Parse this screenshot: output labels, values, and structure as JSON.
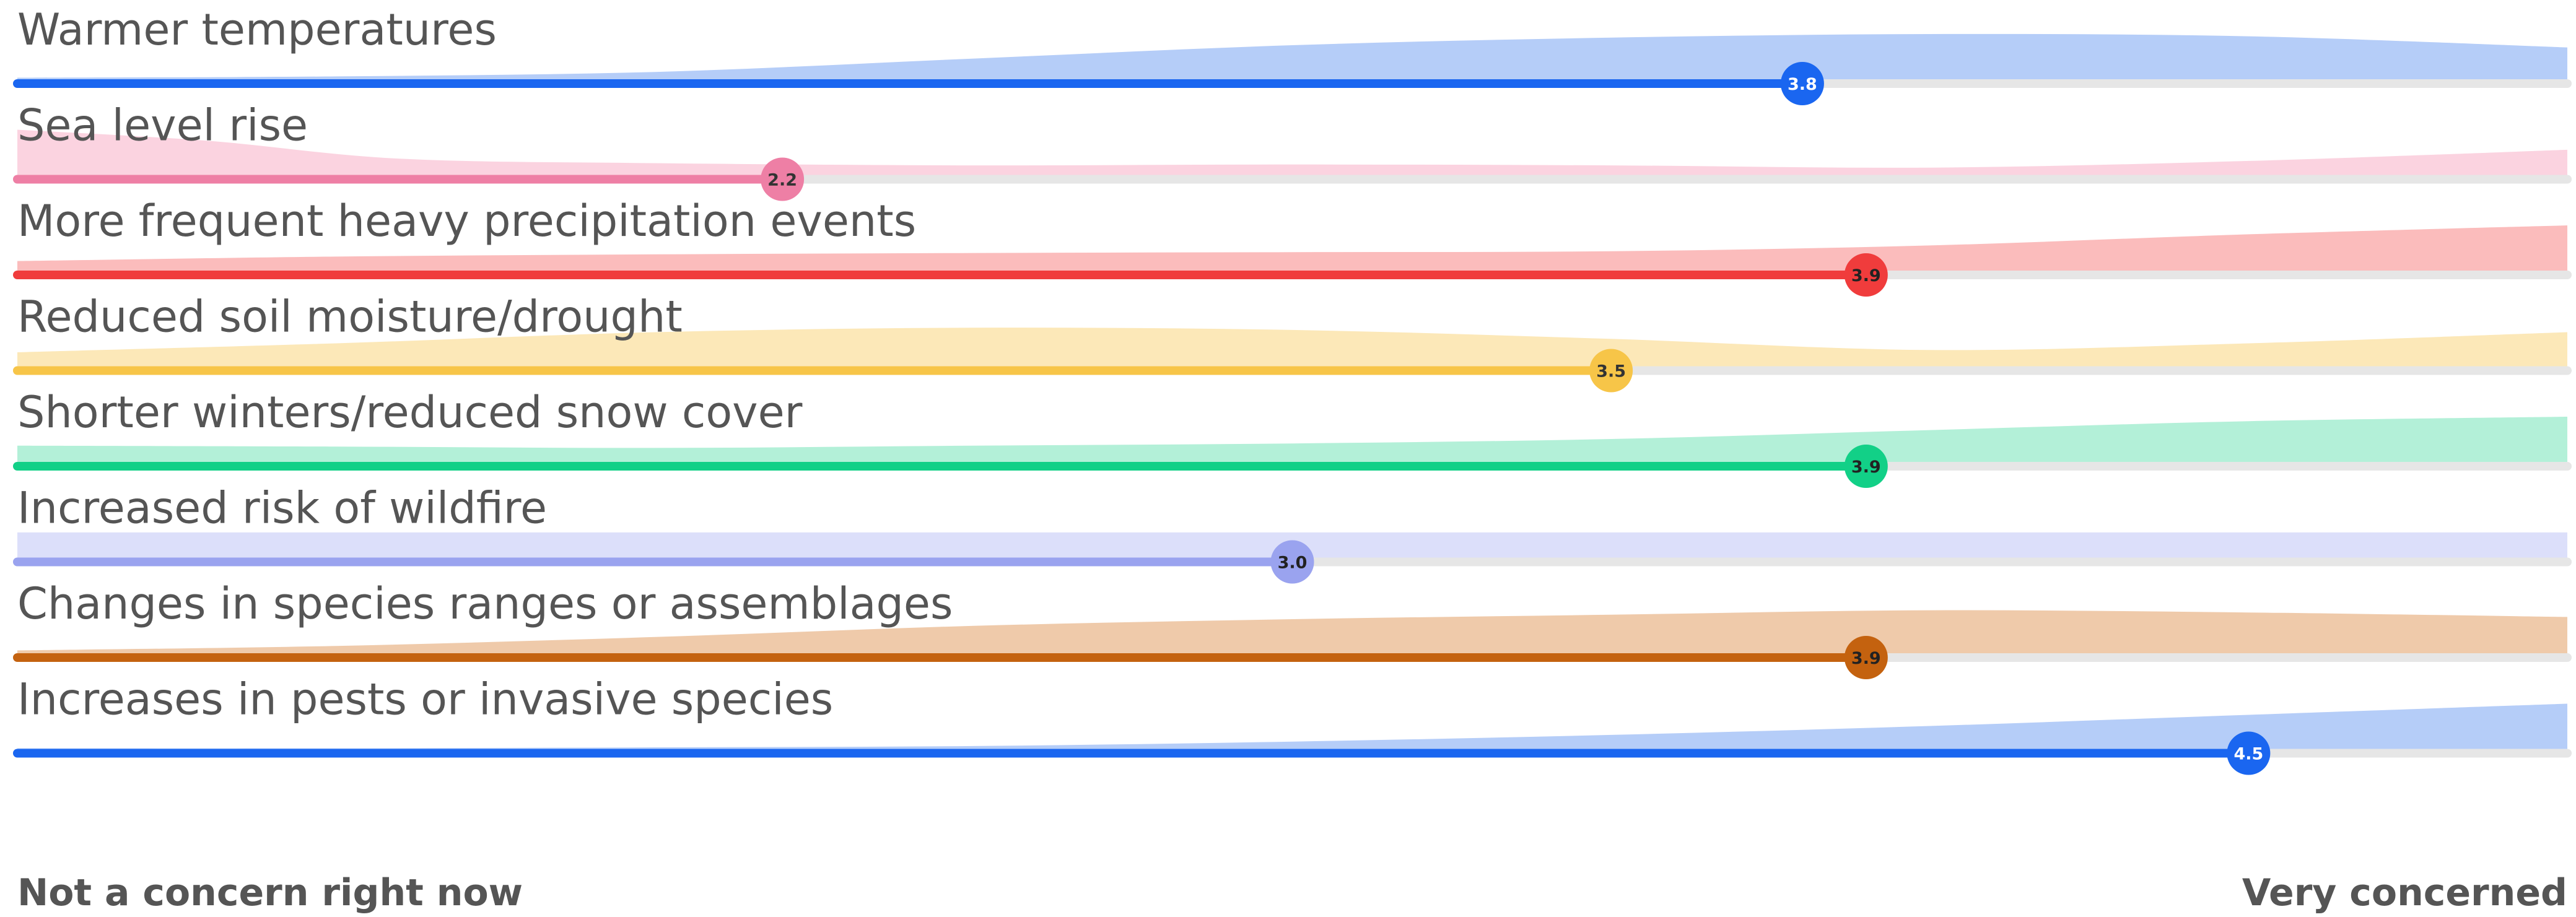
{
  "chart_data": {
    "type": "ridgeline",
    "xlim": [
      1,
      5
    ],
    "low_label": "Not a concern right now",
    "high_label": "Very concerned",
    "track_color": "#e6e6e6",
    "rows": [
      {
        "label": "Warmer temperatures",
        "mean": 3.8,
        "mean_label": "3.8",
        "color": "#1a66f0",
        "fill": "#b5cdf8",
        "label_color": "#ffffff",
        "density": [
          [
            1.0,
            0.02
          ],
          [
            1.5,
            0.05
          ],
          [
            2.0,
            0.15
          ],
          [
            2.5,
            0.45
          ],
          [
            3.0,
            0.75
          ],
          [
            3.5,
            0.92
          ],
          [
            4.0,
            1.0
          ],
          [
            4.5,
            0.95
          ],
          [
            5.0,
            0.7
          ]
        ]
      },
      {
        "label": "Sea level rise",
        "mean": 2.2,
        "mean_label": "2.2",
        "color": "#ee7fa5",
        "fill": "#fbd3e0",
        "label_color": "#333333",
        "density": [
          [
            1.0,
            1.0
          ],
          [
            1.3,
            0.75
          ],
          [
            1.6,
            0.35
          ],
          [
            2.0,
            0.25
          ],
          [
            2.5,
            0.2
          ],
          [
            3.0,
            0.22
          ],
          [
            3.5,
            0.2
          ],
          [
            4.0,
            0.15
          ],
          [
            4.5,
            0.3
          ],
          [
            5.0,
            0.55
          ]
        ]
      },
      {
        "label": "More frequent heavy precipitation events",
        "mean": 3.9,
        "mean_label": "3.9",
        "color": "#f03c3c",
        "fill": "#fbbcbc",
        "label_color": "#222222",
        "density": [
          [
            1.0,
            0.2
          ],
          [
            1.5,
            0.3
          ],
          [
            2.0,
            0.35
          ],
          [
            2.5,
            0.38
          ],
          [
            3.0,
            0.4
          ],
          [
            3.5,
            0.42
          ],
          [
            4.0,
            0.55
          ],
          [
            4.5,
            0.8
          ],
          [
            5.0,
            1.0
          ]
        ]
      },
      {
        "label": "Reduced soil moisture/drought",
        "mean": 3.5,
        "mean_label": "3.5",
        "color": "#f7c548",
        "fill": "#fce8b8",
        "label_color": "#333333",
        "density": [
          [
            1.0,
            0.3
          ],
          [
            1.5,
            0.5
          ],
          [
            2.0,
            0.75
          ],
          [
            2.5,
            0.85
          ],
          [
            3.0,
            0.8
          ],
          [
            3.5,
            0.6
          ],
          [
            4.0,
            0.35
          ],
          [
            4.5,
            0.5
          ],
          [
            5.0,
            0.75
          ]
        ]
      },
      {
        "label": "Shorter winters/reduced snow cover",
        "mean": 3.9,
        "mean_label": "3.9",
        "color": "#12d087",
        "fill": "#b3f0d8",
        "label_color": "#222222",
        "density": [
          [
            1.0,
            0.35
          ],
          [
            1.5,
            0.33
          ],
          [
            2.0,
            0.3
          ],
          [
            2.5,
            0.35
          ],
          [
            3.0,
            0.4
          ],
          [
            3.5,
            0.5
          ],
          [
            4.0,
            0.7
          ],
          [
            4.5,
            0.9
          ],
          [
            5.0,
            1.0
          ]
        ]
      },
      {
        "label": "Increased risk of wildfire",
        "mean": 3.0,
        "mean_label": "3.0",
        "color": "#9aa3ef",
        "fill": "#dcdffa",
        "label_color": "#222222",
        "density": [
          [
            1.0,
            0.55
          ],
          [
            1.5,
            0.55
          ],
          [
            2.0,
            0.55
          ],
          [
            2.5,
            0.55
          ],
          [
            3.0,
            0.55
          ],
          [
            3.5,
            0.55
          ],
          [
            4.0,
            0.55
          ],
          [
            4.5,
            0.55
          ],
          [
            5.0,
            0.55
          ]
        ]
      },
      {
        "label": "Changes in species ranges or assemblages",
        "mean": 3.9,
        "mean_label": "3.9",
        "color": "#c4620f",
        "fill": "#efcaaa",
        "label_color": "#222222",
        "density": [
          [
            1.0,
            0.05
          ],
          [
            1.5,
            0.15
          ],
          [
            2.0,
            0.35
          ],
          [
            2.5,
            0.6
          ],
          [
            3.0,
            0.75
          ],
          [
            3.5,
            0.85
          ],
          [
            4.0,
            0.95
          ],
          [
            4.5,
            0.9
          ],
          [
            5.0,
            0.8
          ]
        ]
      },
      {
        "label": "Increases in pests or invasive species",
        "mean": 4.5,
        "mean_label": "4.5",
        "color": "#1a66f0",
        "fill": "#b5cdf8",
        "label_color": "#ffffff",
        "density": [
          [
            1.0,
            0.0
          ],
          [
            1.5,
            0.0
          ],
          [
            2.0,
            0.02
          ],
          [
            2.5,
            0.05
          ],
          [
            3.0,
            0.15
          ],
          [
            3.5,
            0.3
          ],
          [
            4.0,
            0.5
          ],
          [
            4.5,
            0.75
          ],
          [
            5.0,
            1.0
          ]
        ]
      }
    ]
  }
}
